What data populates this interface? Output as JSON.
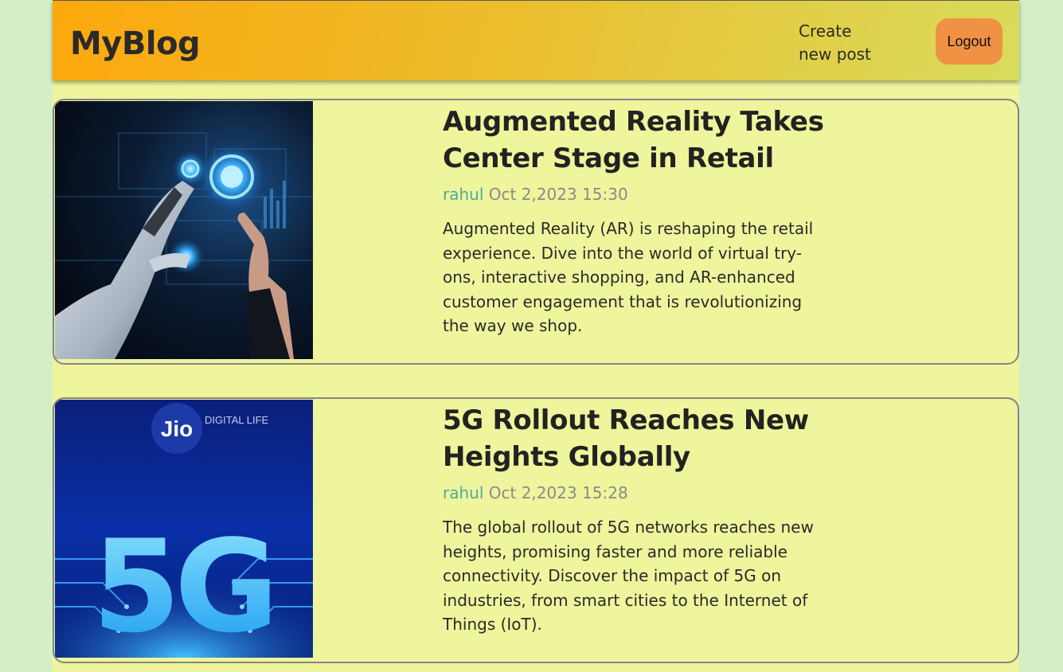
{
  "header": {
    "logo": "MyBlog",
    "create_link": "Create new post",
    "logout_label": "Logout"
  },
  "posts": [
    {
      "title": "Augmented Reality Takes Center Stage in Retail",
      "author": "rahul",
      "date": "Oct 2,2023 15:30",
      "summary": "Augmented Reality (AR) is reshaping the retail experience. Dive into the world of virtual try-ons, interactive shopping, and AR-enhanced customer engagement that is revolutionizing the way we shop."
    },
    {
      "title": "5G Rollout Reaches New Heights Globally",
      "author": "rahul",
      "date": "Oct 2,2023 15:28",
      "summary": "The global rollout of 5G networks reaches new heights, promising faster and more reliable connectivity. Discover the impact of 5G on industries, from smart cities to the Internet of Things (IoT).",
      "image_logo_text": "Jio",
      "image_logo_sub": "DIGITAL LIFE",
      "image_big_text": "5G"
    }
  ]
}
